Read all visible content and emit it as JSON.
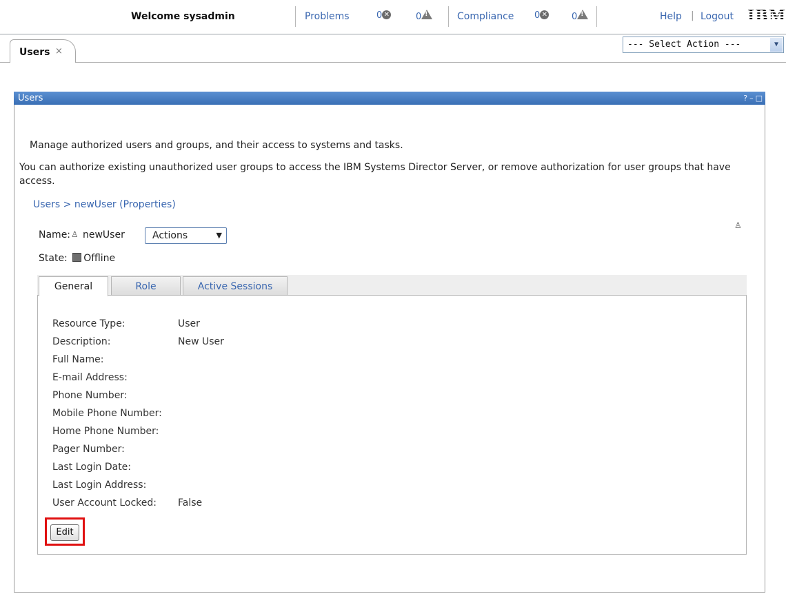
{
  "header": {
    "welcome": "Welcome sysadmin",
    "problems_label": "Problems",
    "problems_errors": "0",
    "problems_warnings": "0",
    "compliance_label": "Compliance",
    "compliance_errors": "0",
    "compliance_warnings": "0",
    "help_label": "Help",
    "separator": "|",
    "logout_label": "Logout",
    "logo_text": "IBM."
  },
  "page_tabs": [
    {
      "label": "Users",
      "close": "×"
    }
  ],
  "select_action": {
    "value": "--- Select Action ---"
  },
  "portlet": {
    "title": "Users",
    "controls": {
      "help": "?",
      "minimize": "–",
      "maximize": "□"
    },
    "description_1": "Manage authorized users and groups, and their access to systems and tasks.",
    "description_2": "You can authorize existing unauthorized user groups to access the IBM Systems Director Server, or remove authorization for user groups that have access.",
    "breadcrumb": "Users > newUser (Properties)",
    "name_label": "Name:",
    "name_value": "newUser",
    "actions_label": "Actions",
    "state_label": "State:",
    "state_value": "Offline",
    "tabs": [
      {
        "label": "General",
        "active": true
      },
      {
        "label": "Role",
        "active": false
      },
      {
        "label": "Active Sessions",
        "active": false
      }
    ],
    "properties": [
      {
        "label": "Resource Type:",
        "value": "User"
      },
      {
        "label": "Description:",
        "value": "New User"
      },
      {
        "label": "Full Name:",
        "value": ""
      },
      {
        "label": "E-mail Address:",
        "value": ""
      },
      {
        "label": "Phone Number:",
        "value": ""
      },
      {
        "label": "Mobile Phone Number:",
        "value": ""
      },
      {
        "label": "Home Phone Number:",
        "value": ""
      },
      {
        "label": "Pager Number:",
        "value": ""
      },
      {
        "label": "Last Login Date:",
        "value": ""
      },
      {
        "label": "Last Login Address:",
        "value": ""
      },
      {
        "label": "User Account Locked:",
        "value": "False"
      }
    ],
    "edit_label": "Edit"
  },
  "colors": {
    "title_bar": "#3a6fb5",
    "link": "#3a67b0",
    "highlight": "#e01010"
  }
}
